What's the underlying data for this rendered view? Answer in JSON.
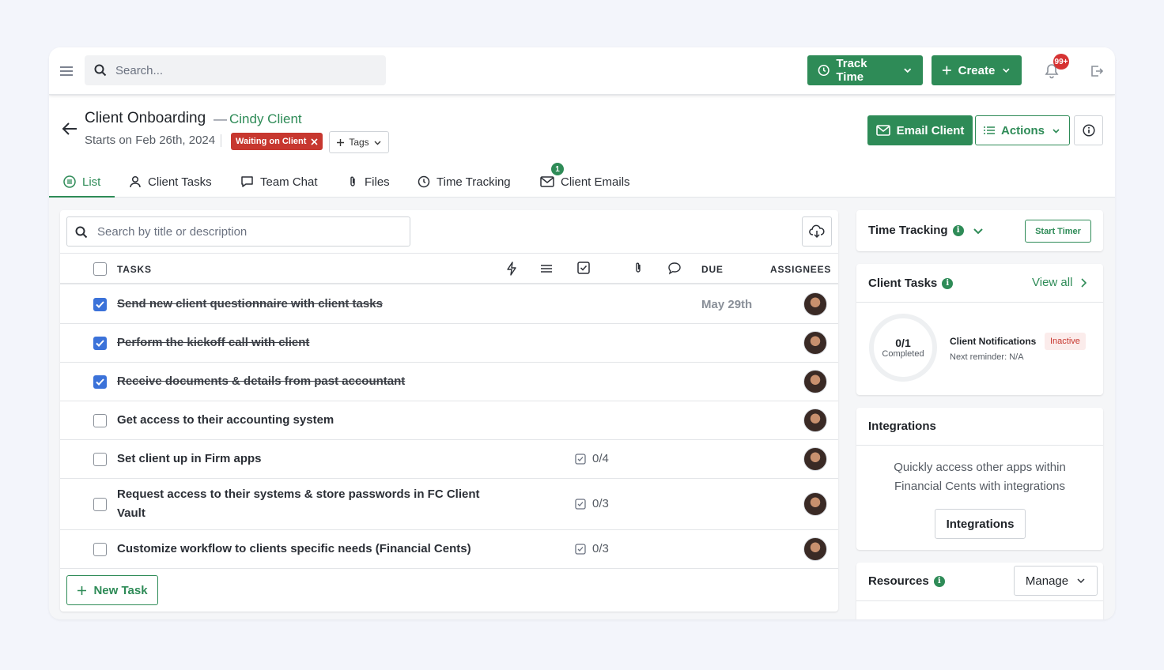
{
  "topbar": {
    "search_placeholder": "Search...",
    "track_time_label": "Track Time",
    "create_label": "Create",
    "notification_count": "99+"
  },
  "header": {
    "title": "Client Onboarding",
    "separator": "—",
    "client_name": "Cindy Client",
    "start_text": "Starts on Feb 26th, 2024",
    "status_label": "Waiting on Client",
    "tags_label": "Tags",
    "email_client_label": "Email Client",
    "actions_label": "Actions"
  },
  "tabs": [
    {
      "label": "List",
      "icon": "list-icon",
      "active": true
    },
    {
      "label": "Client Tasks",
      "icon": "user-icon"
    },
    {
      "label": "Team Chat",
      "icon": "chat-icon"
    },
    {
      "label": "Files",
      "icon": "paperclip-icon"
    },
    {
      "label": "Time Tracking",
      "icon": "clock-icon"
    },
    {
      "label": "Client Emails",
      "icon": "mail-icon",
      "badge": "1"
    }
  ],
  "tasks_panel": {
    "search_placeholder": "Search by title or description",
    "columns": {
      "tasks": "TASKS",
      "due": "DUE",
      "assignees": "ASSIGNEES"
    },
    "rows": [
      {
        "name": "Send new client questionnaire with client tasks",
        "done": true,
        "due": "May 29th",
        "subtasks": ""
      },
      {
        "name": "Perform the kickoff call with client",
        "done": true,
        "due": "",
        "subtasks": ""
      },
      {
        "name": "Receive documents & details from past accountant",
        "done": true,
        "due": "",
        "subtasks": ""
      },
      {
        "name": "Get access to their accounting system",
        "done": false,
        "due": "",
        "subtasks": ""
      },
      {
        "name": "Set client up in Firm apps",
        "done": false,
        "due": "",
        "subtasks": "0/4"
      },
      {
        "name": "Request access to their systems & store passwords in FC Client Vault",
        "done": false,
        "due": "",
        "subtasks": "0/3"
      },
      {
        "name": "Customize workflow to clients specific needs (Financial Cents)",
        "done": false,
        "due": "",
        "subtasks": "0/3"
      }
    ],
    "new_task_label": "New Task"
  },
  "sidebar": {
    "time_tracking": {
      "title": "Time Tracking",
      "start_timer_label": "Start Timer"
    },
    "client_tasks": {
      "title": "Client Tasks",
      "view_all_label": "View all",
      "completed_count": "0/1",
      "completed_label": "Completed",
      "notifications_title": "Client Notifications",
      "notifications_status": "Inactive",
      "next_reminder": "Next reminder: N/A"
    },
    "integrations": {
      "title": "Integrations",
      "description": "Quickly access other apps within Financial Cents with integrations",
      "button_label": "Integrations"
    },
    "resources": {
      "title": "Resources",
      "manage_label": "Manage"
    }
  },
  "colors": {
    "accent": "#2e8b57",
    "status_red": "#c7372f",
    "checkbox_blue": "#3b72d9"
  }
}
